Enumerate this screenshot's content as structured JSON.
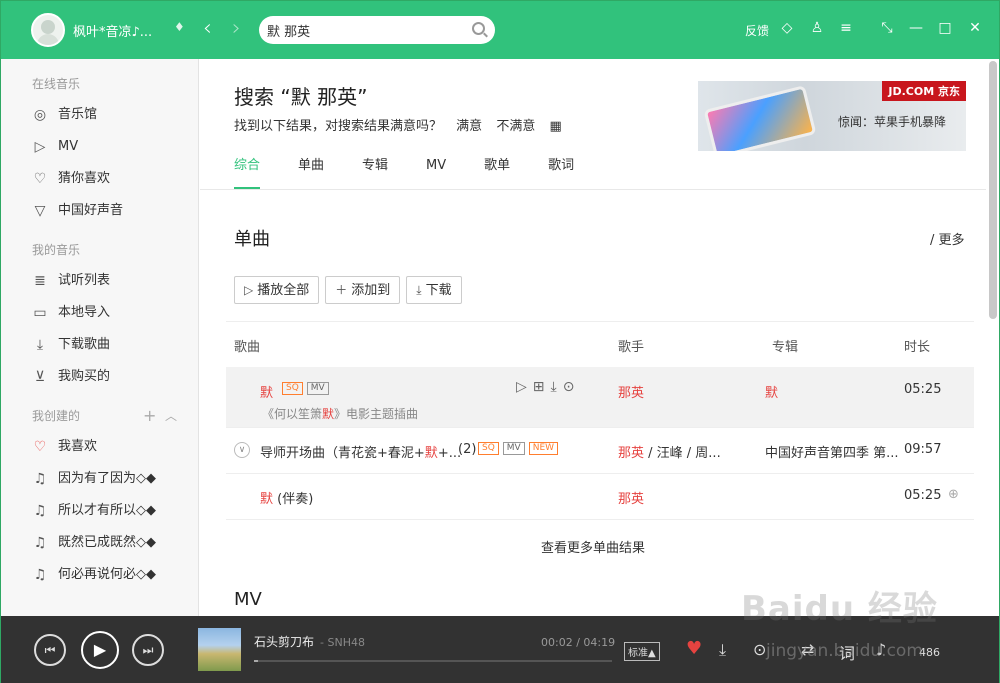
{
  "header": {
    "username": "枫叶*音凉♪...",
    "search_value": "默 那英",
    "feedback": "反馈"
  },
  "sidebar": {
    "online_title": "在线音乐",
    "online": [
      {
        "label": "音乐馆",
        "icon": "music-hall-icon"
      },
      {
        "label": "MV",
        "icon": "mv-icon"
      },
      {
        "label": "猜你喜欢",
        "icon": "heart-outline-icon"
      },
      {
        "label": "中国好声音",
        "icon": "voice-icon"
      }
    ],
    "my_title": "我的音乐",
    "my": [
      {
        "label": "试听列表",
        "icon": "playlist-icon"
      },
      {
        "label": "本地导入",
        "icon": "monitor-icon"
      },
      {
        "label": "下载歌曲",
        "icon": "download-icon"
      },
      {
        "label": "我购买的",
        "icon": "cart-icon"
      }
    ],
    "created_title": "我创建的",
    "created": [
      {
        "label": "我喜欢",
        "icon": "heart-icon"
      },
      {
        "label": "因为有了因为◇◆",
        "icon": "note-icon"
      },
      {
        "label": "所以才有所以◇◆",
        "icon": "note-icon"
      },
      {
        "label": "既然已成既然◇◆",
        "icon": "note-icon"
      },
      {
        "label": "何必再说何必◇◆",
        "icon": "note-icon"
      }
    ]
  },
  "main": {
    "title": "搜索 “默 那英”",
    "hint": "找到以下结果，对搜索结果满意吗？",
    "satisfied": "满意",
    "unsatisfied": "不满意",
    "ad": {
      "brand": "JD.COM 京东",
      "text": "惊闻：苹果手机暴降"
    },
    "tabs": [
      "综合",
      "单曲",
      "专辑",
      "MV",
      "歌单",
      "歌词"
    ],
    "section_title": "单曲",
    "more": "/ 更多",
    "buttons": {
      "play_all": "播放全部",
      "add_to": "添加到",
      "download": "下载"
    },
    "columns": {
      "song": "歌曲",
      "singer": "歌手",
      "album": "专辑",
      "duration": "时长"
    },
    "rows": [
      {
        "title": "默",
        "subtitle_pre": "《何以笙箫",
        "subtitle_hl": "默",
        "subtitle_post": "》电影主题插曲",
        "singer": "那英",
        "album": "默",
        "duration": "05:25"
      },
      {
        "title_pre": "导师开场曲（青花瓷+春泥+",
        "title_hl": "默",
        "title_post": "+...",
        "count": "(2)",
        "singer_hl": "那英",
        "singer_rest": " / 汪峰 / 周...",
        "album": "中国好声音第四季 第...",
        "duration": "09:57"
      },
      {
        "title": "默",
        "suffix": " (伴奏)",
        "singer": "那英",
        "duration": "05:25"
      }
    ],
    "view_more": "查看更多单曲结果",
    "mv_title": "MV"
  },
  "player": {
    "song": "石头剪刀布",
    "artist": "- SNH48",
    "time": "00:02 / 04:19",
    "progress": 0.01,
    "quality": "标准",
    "count": "486"
  },
  "watermark": {
    "text": "Baidu 经验",
    "url": "jingyan.baidu.com"
  }
}
